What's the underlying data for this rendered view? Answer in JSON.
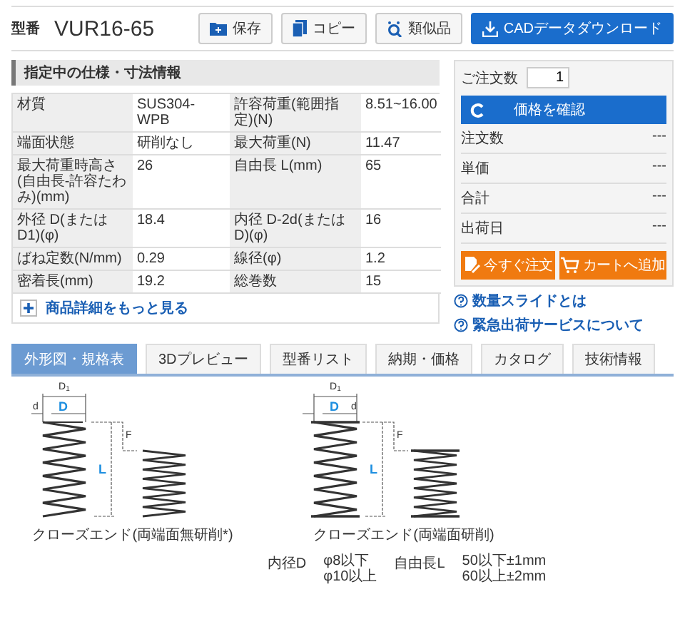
{
  "header": {
    "label": "型番",
    "part_number": "VUR16-65",
    "buttons": [
      {
        "kind": "save",
        "label": "保存"
      },
      {
        "kind": "copy",
        "label": "コピー"
      },
      {
        "kind": "similar",
        "label": "類似品"
      },
      {
        "kind": "cad",
        "label": "CADデータダウンロード"
      }
    ]
  },
  "specs": {
    "title": "指定中の仕様・寸法情報",
    "rows": [
      [
        {
          "label": "材質",
          "value": "SUS304-WPB"
        },
        {
          "label": "許容荷重(範囲指定)(N)",
          "value": "8.51~16.00"
        }
      ],
      [
        {
          "label": "端面状態",
          "value": "研削なし"
        },
        {
          "label": "最大荷重(N)",
          "value": "11.47"
        }
      ],
      [
        {
          "label": "最大荷重時高さ(自由長-許容たわみ)(mm)",
          "value": "26"
        },
        {
          "label": "自由長 L(mm)",
          "value": "65"
        }
      ],
      [
        {
          "label": "外径 D(またはD1)(φ)",
          "value": "18.4"
        },
        {
          "label": "内径 D-2d(またはD)(φ)",
          "value": "16"
        }
      ],
      [
        {
          "label": "ばね定数(N/mm)",
          "value": "0.29"
        },
        {
          "label": "線径(φ)",
          "value": "1.2"
        }
      ],
      [
        {
          "label": "密着長(mm)",
          "value": "19.2"
        },
        {
          "label": "総巻数",
          "value": "15"
        }
      ]
    ],
    "more_link": "商品詳細をもっと見る"
  },
  "order": {
    "quantity_label": "ご注文数",
    "quantity": "1",
    "check_price": "価格を確認",
    "rows": [
      {
        "label": "注文数",
        "value": "---"
      },
      {
        "label": "単価",
        "value": "---"
      },
      {
        "label": "合計",
        "value": "---"
      },
      {
        "label": "出荷日",
        "value": "---"
      }
    ],
    "buttons": [
      {
        "kind": "order",
        "label": "今すぐ注文"
      },
      {
        "kind": "cart",
        "label": "カートへ追加"
      }
    ]
  },
  "help_links": [
    "数量スライドとは",
    "緊急出荷サービスについて"
  ],
  "tabs": [
    {
      "label": "外形図・規格表",
      "selected": true
    },
    {
      "label": "3Dプレビュー",
      "selected": false
    },
    {
      "label": "型番リスト",
      "selected": false
    },
    {
      "label": "納期・価格",
      "selected": false
    },
    {
      "label": "カタログ",
      "selected": false
    },
    {
      "label": "技術情報",
      "selected": false
    }
  ],
  "drawings": [
    {
      "kind": "unground",
      "caption": "クローズエンド(両端面無研削*)",
      "labels": {
        "outer": "D$_{1}$",
        "wire": "d",
        "inner": "D",
        "deflection": "F",
        "length": "L"
      }
    },
    {
      "kind": "ground",
      "caption": "クローズエンド(両端面研削)",
      "labels": {
        "outer": "D$_{1}$",
        "wire": "d",
        "inner": "D",
        "deflection": "F",
        "length": "L"
      }
    }
  ],
  "tolerances": [
    {
      "label": "内径D",
      "lines": [
        "φ8以下",
        "φ10以上"
      ]
    },
    {
      "label": "自由長L",
      "lines": [
        "50以下±1mm",
        "60以上±2mm"
      ]
    }
  ]
}
